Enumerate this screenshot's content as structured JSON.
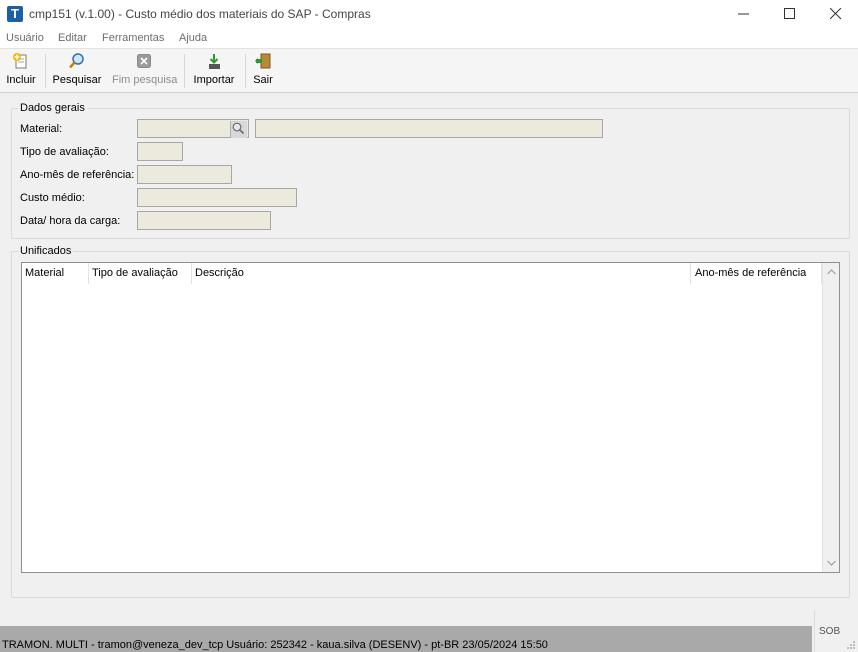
{
  "window": {
    "title": "cmp151 (v.1.00) - Custo médio dos materiais do SAP - Compras",
    "app_icon_letter": "T"
  },
  "menu": [
    "Usuário",
    "Editar",
    "Ferramentas",
    "Ajuda"
  ],
  "toolbar": {
    "incluir": "Incluir",
    "pesquisar": "Pesquisar",
    "fim_pesquisa": "Fim pesquisa",
    "importar": "Importar",
    "sair": "Sair"
  },
  "dados_gerais": {
    "title": "Dados gerais",
    "material_label": "Material:",
    "material_value": "",
    "material_desc_value": "",
    "tipo_label": "Tipo de avaliação:",
    "tipo_value": "",
    "ano_mes_label": "Ano-mês de referência:",
    "ano_mes_value": "",
    "custo_label": "Custo médio:",
    "custo_value": "",
    "data_hora_label": "Data/ hora da carga:",
    "data_hora_value": ""
  },
  "unificados": {
    "title": "Unificados",
    "columns": [
      "Material",
      "Tipo de avaliação",
      "Descrição",
      "Ano-mês de referência"
    ],
    "rows": []
  },
  "status": {
    "text": "TRAMON. MULTI - tramon@veneza_dev_tcp    Usuário: 252342 - kaua.silva (DESENV) - pt-BR    23/05/2024 15:50",
    "mode": "SOB"
  },
  "colors": {
    "field_bg": "#eceadc",
    "status_bg": "#a9a9a9",
    "app_icon": "#1c5fa8"
  }
}
